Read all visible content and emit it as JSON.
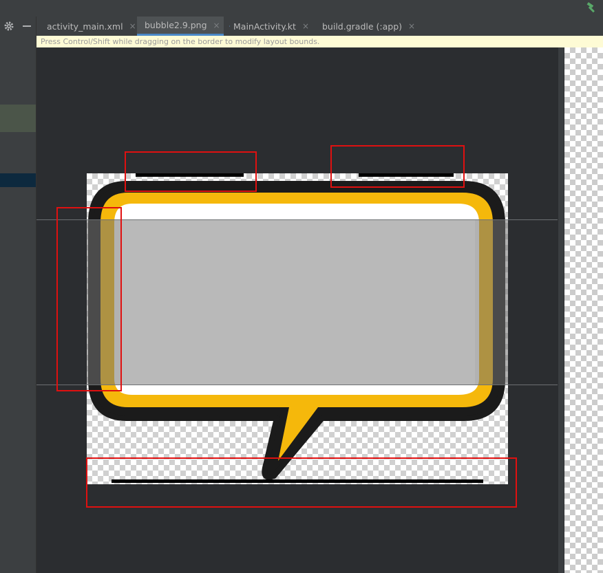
{
  "tabs": [
    {
      "label": "activity_main.xml",
      "icon": "xml-layout-icon",
      "active": false
    },
    {
      "label": "bubble2.9.png",
      "icon": "image-file-icon",
      "active": true
    },
    {
      "label": "MainActivity.kt",
      "icon": "kotlin-class-icon",
      "active": false
    },
    {
      "label": "build.gradle (:app)",
      "icon": "gradle-icon",
      "active": false
    }
  ],
  "tab_close_glyph": "×",
  "hint_text": "Press Control/Shift while dragging on the border to modify layout bounds.",
  "toolbar_icons": [
    "gear-icon",
    "minimize-icon",
    "hammer-icon"
  ],
  "colors": {
    "bubble_fill": "#ffffff",
    "bubble_border": "#f5b80b",
    "bubble_outline": "#1b1b1b",
    "selection_box": "#e01010",
    "content_area": "#b4b4b4",
    "active_tab_underline": "#4a88c7",
    "hint_background": "#fefbd5"
  }
}
